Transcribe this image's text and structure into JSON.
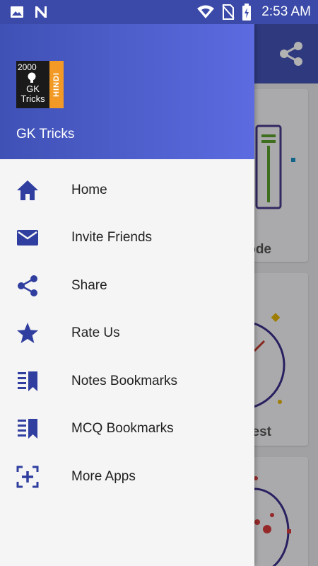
{
  "status_bar": {
    "time": "2:53 AM",
    "left_icons": [
      "image-icon",
      "n-icon"
    ],
    "right_icons": [
      "wifi-icon",
      "no-sim-icon",
      "battery-charging-icon"
    ]
  },
  "drawer": {
    "logo": {
      "year": "2000",
      "line1": "GK",
      "line2": "Tricks",
      "side_text": "HINDI"
    },
    "app_name": "GK Tricks",
    "items": [
      {
        "label": "Home",
        "icon": "home-icon"
      },
      {
        "label": "Invite Friends",
        "icon": "mail-icon"
      },
      {
        "label": "Share",
        "icon": "share-icon"
      },
      {
        "label": "Rate Us",
        "icon": "star-icon"
      },
      {
        "label": "Notes Bookmarks",
        "icon": "notes-bookmark-icon"
      },
      {
        "label": "MCQ Bookmarks",
        "icon": "mcq-bookmark-icon"
      },
      {
        "label": "More Apps",
        "icon": "more-apps-icon"
      }
    ]
  },
  "background": {
    "toolbar_action_icon": "share-icon",
    "card_texts": [
      "ode",
      "est"
    ]
  },
  "colors": {
    "primary": "#3f51b5",
    "primary_light": "#5c6be0",
    "icon": "#303f9f",
    "logo_accent": "#f29a25"
  }
}
